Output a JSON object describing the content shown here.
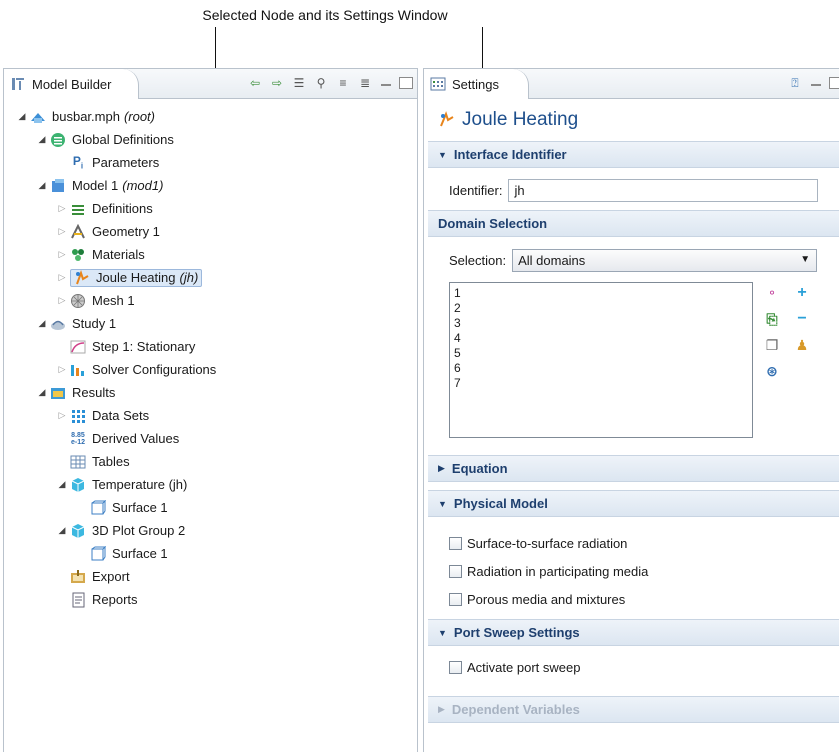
{
  "annotation": {
    "callout": "Selected Node and its Settings Window"
  },
  "model_builder": {
    "tab_label": "Model Builder",
    "tree": [
      {
        "id": "root",
        "label": "busbar.mph",
        "suffix": "(root)",
        "level": 0,
        "toggle": "expanded",
        "icon": "model-file-icon"
      },
      {
        "id": "global-defs",
        "label": "Global Definitions",
        "level": 1,
        "toggle": "expanded",
        "icon": "global-definitions-icon"
      },
      {
        "id": "parameters",
        "label": "Parameters",
        "level": 2,
        "toggle": "none",
        "icon": "parameters-icon",
        "icon_text": "Pi"
      },
      {
        "id": "model1",
        "label": "Model 1",
        "suffix": "(mod1)",
        "level": 1,
        "toggle": "expanded",
        "icon": "model-icon"
      },
      {
        "id": "definitions",
        "label": "Definitions",
        "level": 2,
        "toggle": "collapsed",
        "icon": "definitions-icon"
      },
      {
        "id": "geometry",
        "label": "Geometry 1",
        "level": 2,
        "toggle": "collapsed",
        "icon": "geometry-icon"
      },
      {
        "id": "materials",
        "label": "Materials",
        "level": 2,
        "toggle": "collapsed",
        "icon": "materials-icon"
      },
      {
        "id": "joule",
        "label": "Joule Heating",
        "suffix": "(jh)",
        "level": 2,
        "toggle": "collapsed",
        "icon": "joule-heating-icon",
        "selected": true
      },
      {
        "id": "mesh",
        "label": "Mesh 1",
        "level": 2,
        "toggle": "collapsed",
        "icon": "mesh-icon"
      },
      {
        "id": "study1",
        "label": "Study 1",
        "level": 1,
        "toggle": "expanded",
        "icon": "study-icon"
      },
      {
        "id": "step1",
        "label": "Step 1: Stationary",
        "level": 2,
        "toggle": "none",
        "icon": "stationary-step-icon"
      },
      {
        "id": "solver",
        "label": "Solver Configurations",
        "level": 2,
        "toggle": "collapsed",
        "icon": "solver-configurations-icon"
      },
      {
        "id": "results",
        "label": "Results",
        "level": 1,
        "toggle": "expanded",
        "icon": "results-icon"
      },
      {
        "id": "datasets",
        "label": "Data Sets",
        "level": 2,
        "toggle": "collapsed",
        "icon": "data-sets-icon"
      },
      {
        "id": "derived",
        "label": "Derived Values",
        "level": 2,
        "toggle": "none",
        "icon": "derived-values-icon",
        "icon_text": "8.85 e-12"
      },
      {
        "id": "tables",
        "label": "Tables",
        "level": 2,
        "toggle": "none",
        "icon": "tables-icon"
      },
      {
        "id": "temperature",
        "label": "Temperature (jh)",
        "level": 2,
        "toggle": "expanded",
        "icon": "plot-group-3d-icon"
      },
      {
        "id": "surface1a",
        "label": "Surface 1",
        "level": 3,
        "toggle": "none",
        "icon": "surface-plot-icon"
      },
      {
        "id": "plotgroup2",
        "label": "3D Plot Group 2",
        "level": 2,
        "toggle": "expanded",
        "icon": "plot-group-3d-icon"
      },
      {
        "id": "surface1b",
        "label": "Surface 1",
        "level": 3,
        "toggle": "none",
        "icon": "surface-plot-icon"
      },
      {
        "id": "export",
        "label": "Export",
        "level": 2,
        "toggle": "none",
        "icon": "export-icon"
      },
      {
        "id": "reports",
        "label": "Reports",
        "level": 2,
        "toggle": "none",
        "icon": "reports-icon"
      }
    ]
  },
  "settings": {
    "tab_label": "Settings",
    "title": "Joule Heating",
    "interface_identifier": {
      "header": "Interface Identifier",
      "label": "Identifier:",
      "value": "jh"
    },
    "domain_selection": {
      "header": "Domain Selection",
      "label": "Selection:",
      "value": "All domains",
      "items": [
        "1",
        "2",
        "3",
        "4",
        "5",
        "6",
        "7"
      ]
    },
    "equation": {
      "header": "Equation"
    },
    "physical_model": {
      "header": "Physical Model",
      "options": [
        "Surface-to-surface radiation",
        "Radiation in participating media",
        "Porous media and mixtures"
      ]
    },
    "port_sweep": {
      "header": "Port Sweep Settings",
      "option": "Activate port sweep"
    },
    "dependent_variables": {
      "header": "Dependent Variables"
    }
  },
  "colors": {
    "accent": "#1e4f8c",
    "selection_bg": "#dbe8f7",
    "section_bg": "#dce6f1",
    "green_add": "#2aa0d8"
  }
}
